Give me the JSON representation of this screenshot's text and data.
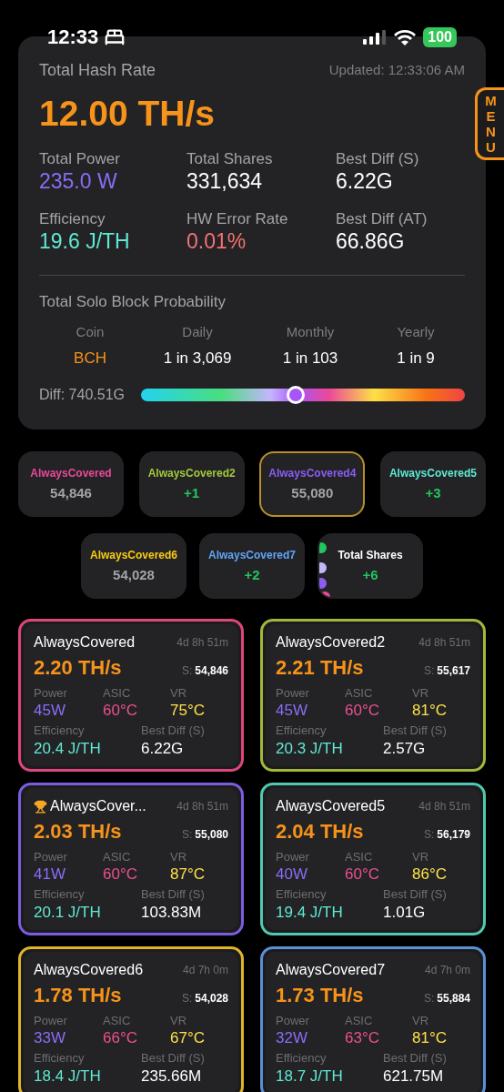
{
  "status_bar": {
    "time": "12:33",
    "battery": "100"
  },
  "summary": {
    "title": "Total Hash Rate",
    "updated": "Updated: 12:33:06 AM",
    "hashrate": "12.00 TH/s",
    "stats": [
      {
        "label": "Total Power",
        "value": "235.0 W",
        "color": "#8b6cf6"
      },
      {
        "label": "Total Shares",
        "value": "331,634",
        "color": "#ffffff"
      },
      {
        "label": "Best Diff (S)",
        "value": "6.22G",
        "color": "#ffffff"
      },
      {
        "label": "Efficiency",
        "value": "19.6 J/TH",
        "color": "#5eead4"
      },
      {
        "label": "HW Error Rate",
        "value": "0.01%",
        "color": "#f87171"
      },
      {
        "label": "Best Diff (AT)",
        "value": "66.86G",
        "color": "#ffffff"
      }
    ],
    "probability_title": "Total Solo Block Probability",
    "probability": [
      {
        "label": "Coin",
        "value": "BCH",
        "color": "#f7931a"
      },
      {
        "label": "Daily",
        "value": "1 in 3,069",
        "color": "#ffffff"
      },
      {
        "label": "Monthly",
        "value": "1 in 103",
        "color": "#ffffff"
      },
      {
        "label": "Yearly",
        "value": "1 in 9",
        "color": "#ffffff"
      }
    ],
    "difficulty": {
      "label": "Diff: 740.51G",
      "level": 0.477
    }
  },
  "menu": {
    "letters": [
      "M",
      "E",
      "N",
      "U"
    ]
  },
  "chips": [
    {
      "name": "AlwaysCovered",
      "value": "54,846",
      "kind": "count",
      "color": "#ec4899",
      "selected": false
    },
    {
      "name": "AlwaysCovered2",
      "value": "+1",
      "kind": "delta",
      "color": "#a3c93a",
      "selected": false
    },
    {
      "name": "AlwaysCovered4",
      "value": "55,080",
      "kind": "count",
      "color": "#8b5cf6",
      "selected": true
    },
    {
      "name": "AlwaysCovered5",
      "value": "+3",
      "kind": "delta",
      "color": "#5eead4",
      "selected": false
    },
    {
      "name": "AlwaysCovered6",
      "value": "54,028",
      "kind": "count",
      "color": "#facc15",
      "selected": false
    },
    {
      "name": "AlwaysCovered7",
      "value": "+2",
      "kind": "delta",
      "color": "#60a5fa",
      "selected": false
    },
    {
      "name": "Total Shares",
      "value": "+6",
      "kind": "delta",
      "color": "#ffffff",
      "selected": false
    }
  ],
  "miners": [
    {
      "name": "AlwaysCovered",
      "trophy": false,
      "uptime": "4d 8h 51m",
      "hashrate": "2.20 TH/s",
      "shares_label": "S:",
      "shares": "54,846",
      "color": "#e0457b",
      "stats": [
        {
          "label": "Power",
          "value": "45W"
        },
        {
          "label": "ASIC",
          "value": "60°C"
        },
        {
          "label": "VR",
          "value": "75°C"
        },
        {
          "label": "Efficiency",
          "value": "20.4 J/TH"
        },
        {
          "label": "Best Diff (S)",
          "value": "6.22G"
        }
      ]
    },
    {
      "name": "AlwaysCovered2",
      "trophy": false,
      "uptime": "4d 8h 51m",
      "hashrate": "2.21 TH/s",
      "shares_label": "S:",
      "shares": "55,617",
      "color": "#a3b83a",
      "stats": [
        {
          "label": "Power",
          "value": "45W"
        },
        {
          "label": "ASIC",
          "value": "60°C"
        },
        {
          "label": "VR",
          "value": "81°C"
        },
        {
          "label": "Efficiency",
          "value": "20.3 J/TH"
        },
        {
          "label": "Best Diff (S)",
          "value": "2.57G"
        }
      ]
    },
    {
      "name": "AlwaysCover...",
      "trophy": true,
      "uptime": "4d 8h 51m",
      "hashrate": "2.03 TH/s",
      "shares_label": "S:",
      "shares": "55,080",
      "color": "#7c5ce0",
      "stats": [
        {
          "label": "Power",
          "value": "41W"
        },
        {
          "label": "ASIC",
          "value": "60°C"
        },
        {
          "label": "VR",
          "value": "87°C"
        },
        {
          "label": "Efficiency",
          "value": "20.1 J/TH"
        },
        {
          "label": "Best Diff (S)",
          "value": "103.83M"
        }
      ]
    },
    {
      "name": "AlwaysCovered5",
      "trophy": false,
      "uptime": "4d 8h 51m",
      "hashrate": "2.04 TH/s",
      "shares_label": "S:",
      "shares": "56,179",
      "color": "#4fc9b0",
      "stats": [
        {
          "label": "Power",
          "value": "40W"
        },
        {
          "label": "ASIC",
          "value": "60°C"
        },
        {
          "label": "VR",
          "value": "86°C"
        },
        {
          "label": "Efficiency",
          "value": "19.4 J/TH"
        },
        {
          "label": "Best Diff (S)",
          "value": "1.01G"
        }
      ]
    },
    {
      "name": "AlwaysCovered6",
      "trophy": false,
      "uptime": "4d 7h 0m",
      "hashrate": "1.78 TH/s",
      "shares_label": "S:",
      "shares": "54,028",
      "color": "#e0b52a",
      "stats": [
        {
          "label": "Power",
          "value": "33W"
        },
        {
          "label": "ASIC",
          "value": "66°C"
        },
        {
          "label": "VR",
          "value": "67°C"
        },
        {
          "label": "Efficiency",
          "value": "18.4 J/TH"
        },
        {
          "label": "Best Diff (S)",
          "value": "235.66M"
        }
      ]
    },
    {
      "name": "AlwaysCovered7",
      "trophy": false,
      "uptime": "4d 7h 0m",
      "hashrate": "1.73 TH/s",
      "shares_label": "S:",
      "shares": "55,884",
      "color": "#5b8fd6",
      "stats": [
        {
          "label": "Power",
          "value": "32W"
        },
        {
          "label": "ASIC",
          "value": "63°C"
        },
        {
          "label": "VR",
          "value": "81°C"
        },
        {
          "label": "Efficiency",
          "value": "18.7 J/TH"
        },
        {
          "label": "Best Diff (S)",
          "value": "621.75M"
        }
      ]
    }
  ]
}
